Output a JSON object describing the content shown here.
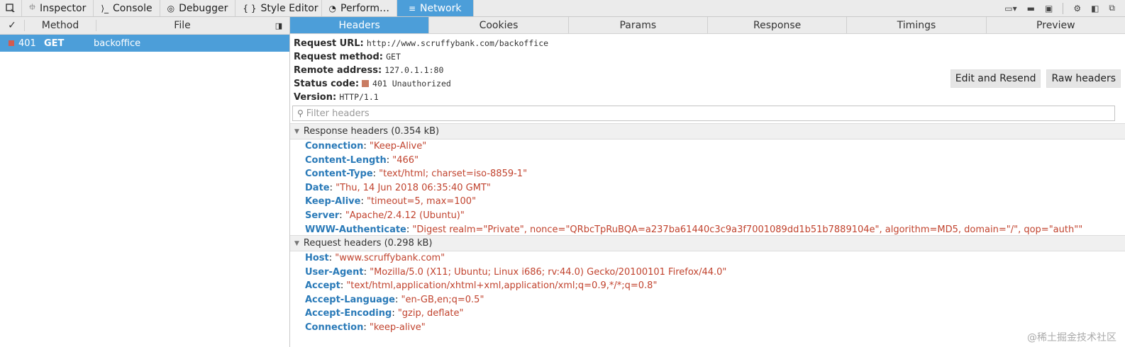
{
  "toolbar": {
    "tabs": [
      {
        "label": "Inspector",
        "icon": "inspector-icon",
        "glyph": "⯐"
      },
      {
        "label": "Console",
        "icon": "console-icon",
        "glyph": "⟩_"
      },
      {
        "label": "Debugger",
        "icon": "debugger-icon",
        "glyph": "◎"
      },
      {
        "label": "Style Editor",
        "icon": "style-editor-icon",
        "glyph": "{ }"
      },
      {
        "label": "Perform…",
        "icon": "performance-icon",
        "glyph": "◔"
      },
      {
        "label": "Network",
        "icon": "network-icon",
        "glyph": "≡"
      }
    ]
  },
  "requests": {
    "headers": {
      "check": "✓",
      "method": "Method",
      "file": "File"
    },
    "rows": [
      {
        "status": "401",
        "method": "GET",
        "file": "backoffice"
      }
    ]
  },
  "panel": {
    "tabs": [
      "Headers",
      "Cookies",
      "Params",
      "Response",
      "Timings",
      "Preview"
    ],
    "summary": {
      "url_label": "Request URL:",
      "url": "http://www.scruffybank.com/backoffice",
      "method_label": "Request method:",
      "method": "GET",
      "remote_label": "Remote address:",
      "remote": "127.0.1.1:80",
      "status_label": "Status code:",
      "status": "401 Unauthorized",
      "version_label": "Version:",
      "version": "HTTP/1.1"
    },
    "buttons": {
      "edit_resend": "Edit and Resend",
      "raw_headers": "Raw headers"
    },
    "filter_placeholder": "Filter headers",
    "response_section": "Response headers (0.354 kB)",
    "response_headers": [
      {
        "name": "Connection",
        "value": "\"Keep-Alive\""
      },
      {
        "name": "Content-Length",
        "value": "\"466\""
      },
      {
        "name": "Content-Type",
        "value": "\"text/html; charset=iso-8859-1\""
      },
      {
        "name": "Date",
        "value": "\"Thu, 14 Jun 2018 06:35:40 GMT\""
      },
      {
        "name": "Keep-Alive",
        "value": "\"timeout=5, max=100\""
      },
      {
        "name": "Server",
        "value": "\"Apache/2.4.12 (Ubuntu)\""
      },
      {
        "name": "WWW-Authenticate",
        "value": "\"Digest realm=\"Private\", nonce=\"QRbcTpRuBQA=a237ba61440c3c9a3f7001089dd1b51b7889104e\", algorithm=MD5, domain=\"/\", qop=\"auth\"\""
      }
    ],
    "request_section": "Request headers (0.298 kB)",
    "request_headers": [
      {
        "name": "Host",
        "value": "\"www.scruffybank.com\""
      },
      {
        "name": "User-Agent",
        "value": "\"Mozilla/5.0 (X11; Ubuntu; Linux i686; rv:44.0) Gecko/20100101 Firefox/44.0\""
      },
      {
        "name": "Accept",
        "value": "\"text/html,application/xhtml+xml,application/xml;q=0.9,*/*;q=0.8\""
      },
      {
        "name": "Accept-Language",
        "value": "\"en-GB,en;q=0.5\""
      },
      {
        "name": "Accept-Encoding",
        "value": "\"gzip, deflate\""
      },
      {
        "name": "Connection",
        "value": "\"keep-alive\""
      }
    ]
  },
  "watermark": "@稀土掘金技术社区",
  "colors": {
    "accent": "#4c9ed9",
    "header_name": "#2a7ab8",
    "header_value": "#c1432e"
  }
}
